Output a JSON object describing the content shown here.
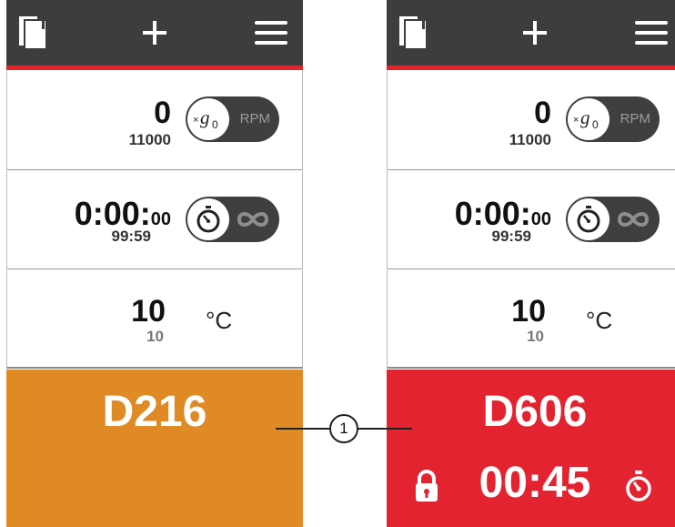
{
  "screens": [
    {
      "speed": {
        "value": "0",
        "setpoint": "11000",
        "toggle_left_icon": "xg0-icon",
        "toggle_right_label": "RPM"
      },
      "time": {
        "value_main": "0:00:",
        "value_small": "00",
        "setpoint": "99:59",
        "toggle_left_icon": "stopwatch-icon",
        "toggle_right_icon": "infinity-icon"
      },
      "temperature": {
        "value": "10",
        "setpoint": "10",
        "unit": "°C"
      },
      "status": {
        "code": "D216",
        "color": "#e08a26"
      }
    },
    {
      "speed": {
        "value": "0",
        "setpoint": "11000",
        "toggle_left_icon": "xg0-icon",
        "toggle_right_label": "RPM"
      },
      "time": {
        "value_main": "0:00:",
        "value_small": "00",
        "setpoint": "99:59",
        "toggle_left_icon": "stopwatch-icon",
        "toggle_right_icon": "infinity-icon"
      },
      "temperature": {
        "value": "10",
        "setpoint": "10",
        "unit": "°C"
      },
      "status": {
        "code": "D606",
        "countdown": "00:45",
        "color": "#e32330"
      }
    }
  ],
  "callout": {
    "number": "1"
  },
  "colors": {
    "topbar": "#3d3d3d",
    "accent": "#e4232b"
  }
}
